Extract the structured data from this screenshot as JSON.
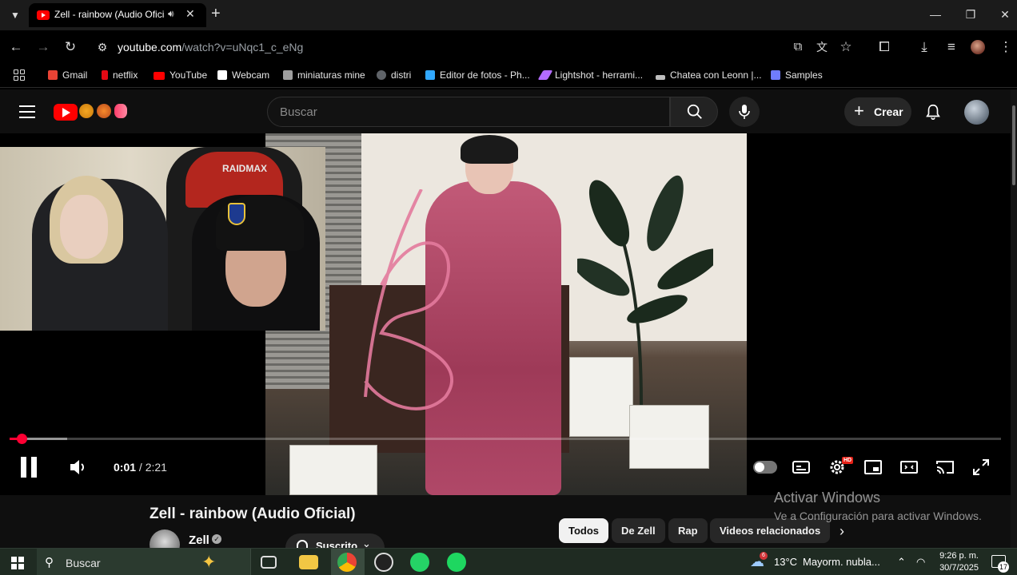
{
  "browser": {
    "tab_title": "Zell - rainbow (Audio Oficial",
    "url_host": "youtube.com",
    "url_path": "/watch?v=uNqc1_c_eNg"
  },
  "bookmarks": [
    {
      "label": "Gmail",
      "color": "#ea4335"
    },
    {
      "label": "netflix",
      "color": "#e50914"
    },
    {
      "label": "YouTube",
      "color": "#ff0000"
    },
    {
      "label": "Webcam",
      "color": "#ffffff"
    },
    {
      "label": "miniaturas mine",
      "color": "#9e9e9e"
    },
    {
      "label": "distri",
      "color": "#5f6368"
    },
    {
      "label": "Editor de fotos - Ph...",
      "color": "#31a8ff"
    },
    {
      "label": "Lightshot - herrami...",
      "color": "#b36bff"
    },
    {
      "label": "Chatea con Leonn |...",
      "color": "#bdbdbd"
    },
    {
      "label": "Samples",
      "color": "#6f7cff"
    }
  ],
  "youtube": {
    "search_placeholder": "Buscar",
    "create_label": "Crear"
  },
  "player": {
    "webcam_chair_label": "RAIDMAX",
    "current_time": "0:01",
    "separator": "/",
    "duration": "2:21",
    "played_fraction": 0.012,
    "buffered_fraction": 0.058,
    "hd_badge": "HD",
    "autoplay_on": false
  },
  "video": {
    "title": "Zell - rainbow (Audio Oficial)",
    "channel": "Zell",
    "subscribe_label": "Suscrito"
  },
  "chips": [
    {
      "label": "Todos",
      "active": true
    },
    {
      "label": "De Zell",
      "active": false
    },
    {
      "label": "Rap",
      "active": false
    },
    {
      "label": "Videos relacionados",
      "active": false
    }
  ],
  "watermark": {
    "title": "Activar Windows",
    "subtitle": "Ve a Configuración para activar Windows."
  },
  "taskbar": {
    "search_placeholder": "Buscar",
    "weather_temp": "13°C",
    "weather_text": "Mayorm. nubla...",
    "weather_badge": "6",
    "time": "9:26 p. m.",
    "date": "30/7/2025",
    "notifications": "17"
  },
  "colors": {
    "youtube_red": "#ff0000",
    "progress_red": "#ff0033",
    "taskbar_bg": "#1f2b22"
  }
}
